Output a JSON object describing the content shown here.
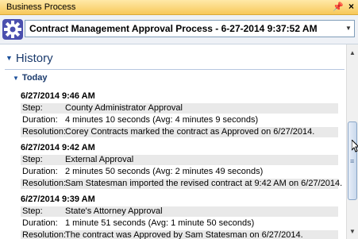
{
  "window": {
    "title": "Business Process",
    "pin": "ᵖ",
    "close": "×"
  },
  "toolbar": {
    "process_label": "Contract Management Approval Process - 6-27-2014 9:37:52 AM"
  },
  "history": {
    "title": "History",
    "group": "Today"
  },
  "labels": {
    "step": "Step:",
    "duration": "Duration:",
    "resolution": "Resolution:"
  },
  "entries": [
    {
      "timestamp": "6/27/2014 9:46 AM",
      "step": "County Administrator Approval",
      "duration": "4 minutes 10 seconds (Avg: 4 minutes 9 seconds)",
      "resolution": "Corey Contracts marked the contract as Approved on 6/27/2014."
    },
    {
      "timestamp": "6/27/2014 9:42 AM",
      "step": "External Approval",
      "duration": "2 minutes 50 seconds (Avg: 2 minutes 49 seconds)",
      "resolution": "Sam Statesman imported the revised contract at 9:42 AM on 6/27/2014."
    },
    {
      "timestamp": "6/27/2014 9:39 AM",
      "step": "State's Attorney Approval",
      "duration": "1 minute 51 seconds (Avg: 1 minute 50 seconds)",
      "resolution": "The contract was Approved by Sam Statesman on 6/27/2014."
    }
  ]
}
